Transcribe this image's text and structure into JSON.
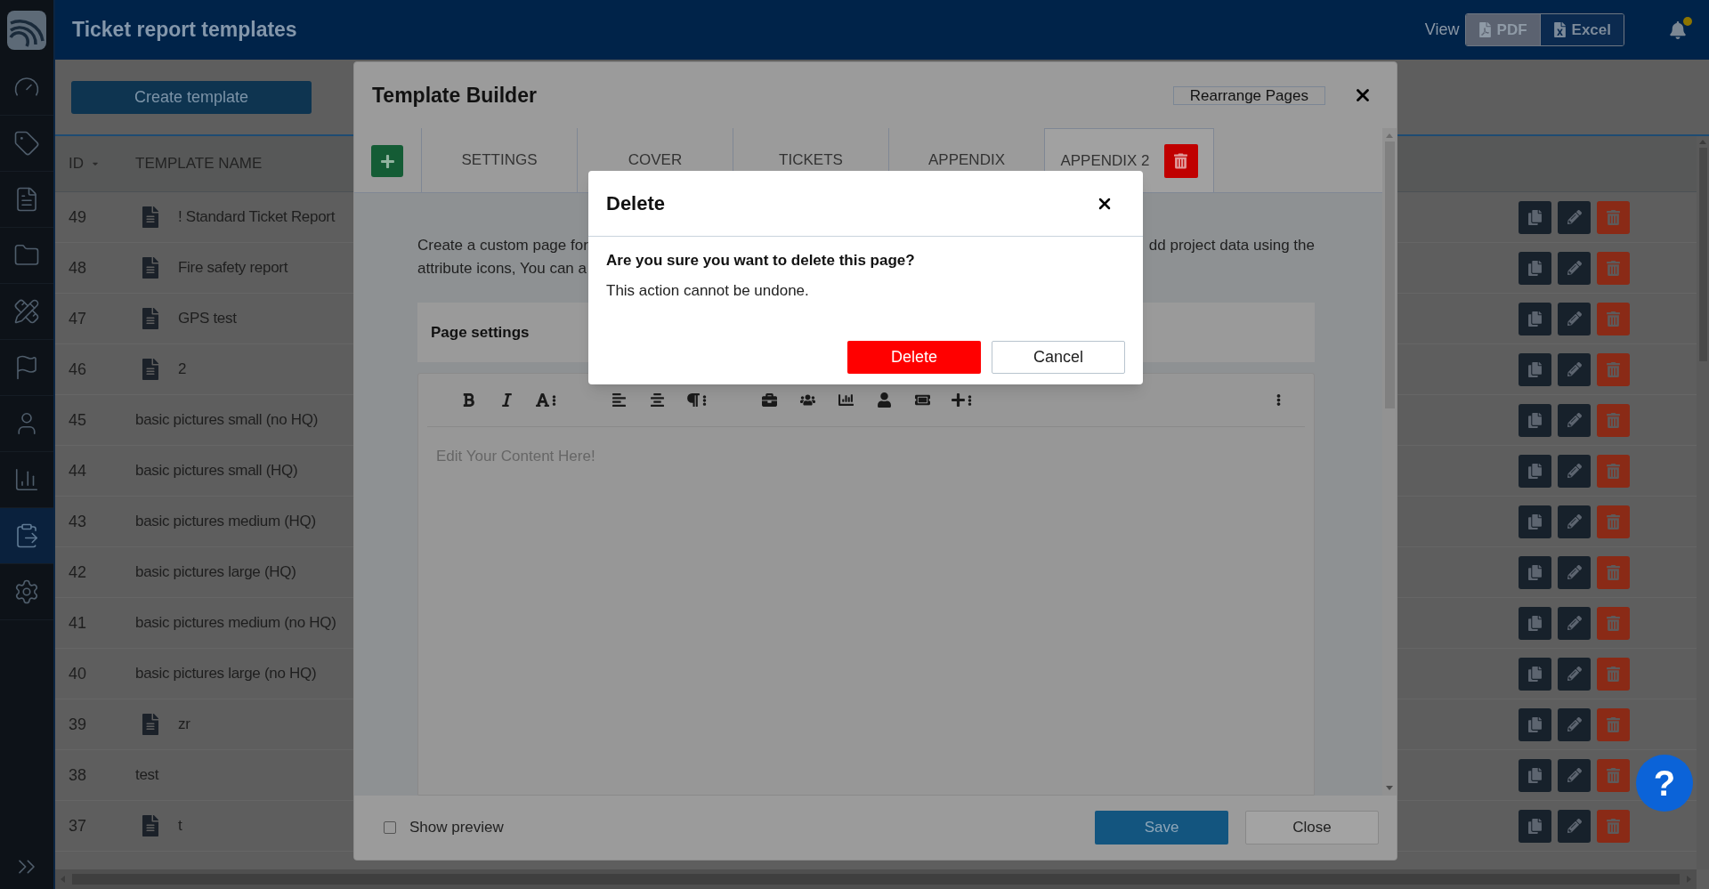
{
  "header": {
    "title": "Ticket report templates",
    "view_label": "View",
    "view_options": [
      {
        "label": "PDF",
        "selected": true
      },
      {
        "label": "Excel",
        "selected": false
      }
    ],
    "notification_dot": true
  },
  "sidebar": {
    "items": [
      {
        "selected": false
      },
      {
        "selected": false
      },
      {
        "selected": false
      },
      {
        "selected": false
      },
      {
        "selected": false
      },
      {
        "selected": false
      },
      {
        "selected": false
      },
      {
        "selected": false
      },
      {
        "selected": true
      },
      {
        "selected": false
      }
    ]
  },
  "toolbar": {
    "create_button": "Create template"
  },
  "table": {
    "columns": [
      {
        "label": "ID",
        "sorted": true
      },
      {
        "label": "TEMPLATE NAME",
        "sorted": false
      }
    ],
    "rows": [
      {
        "id": "49",
        "name": "! Standard Ticket Report",
        "report_icon": true
      },
      {
        "id": "48",
        "name": "Fire safety report",
        "report_icon": true
      },
      {
        "id": "47",
        "name": "GPS test",
        "report_icon": true
      },
      {
        "id": "46",
        "name": "2",
        "report_icon": true
      },
      {
        "id": "45",
        "name": "basic pictures small (no HQ)",
        "report_icon": false
      },
      {
        "id": "44",
        "name": "basic pictures small (HQ)",
        "report_icon": false
      },
      {
        "id": "43",
        "name": "basic pictures medium (HQ)",
        "report_icon": false
      },
      {
        "id": "42",
        "name": "basic pictures large (HQ)",
        "report_icon": false
      },
      {
        "id": "41",
        "name": "basic pictures medium (no HQ)",
        "report_icon": false
      },
      {
        "id": "40",
        "name": "basic pictures large (no HQ)",
        "report_icon": false
      },
      {
        "id": "39",
        "name": "zr",
        "report_icon": true
      },
      {
        "id": "38",
        "name": "test",
        "report_icon": false
      },
      {
        "id": "37",
        "name": "t",
        "report_icon": true
      }
    ]
  },
  "template_builder": {
    "title": "Template Builder",
    "rearrange_button": "Rearrange Pages",
    "tabs": [
      {
        "label": "SETTINGS",
        "selected": false
      },
      {
        "label": "COVER",
        "selected": false
      },
      {
        "label": "TICKETS",
        "selected": false
      },
      {
        "label": "APPENDIX",
        "selected": false
      },
      {
        "label": "APPENDIX 2",
        "selected": true
      }
    ],
    "description": {
      "left_lines": [
        "Create a custom page for",
        "attribute icons, You can a"
      ],
      "right_lines": [
        "dd project data using the"
      ]
    },
    "page_settings_label": "Page settings",
    "editor_placeholder": "Edit Your Content Here!",
    "show_preview": {
      "label": "Show preview",
      "checked": false
    },
    "save_button": "Save",
    "close_button": "Close"
  },
  "dialog": {
    "title": "Delete",
    "question": "Are you sure you want to delete this page?",
    "message": "This action cannot be undone.",
    "confirm_button": "Delete",
    "cancel_button": "Cancel"
  },
  "help_button": "?"
}
